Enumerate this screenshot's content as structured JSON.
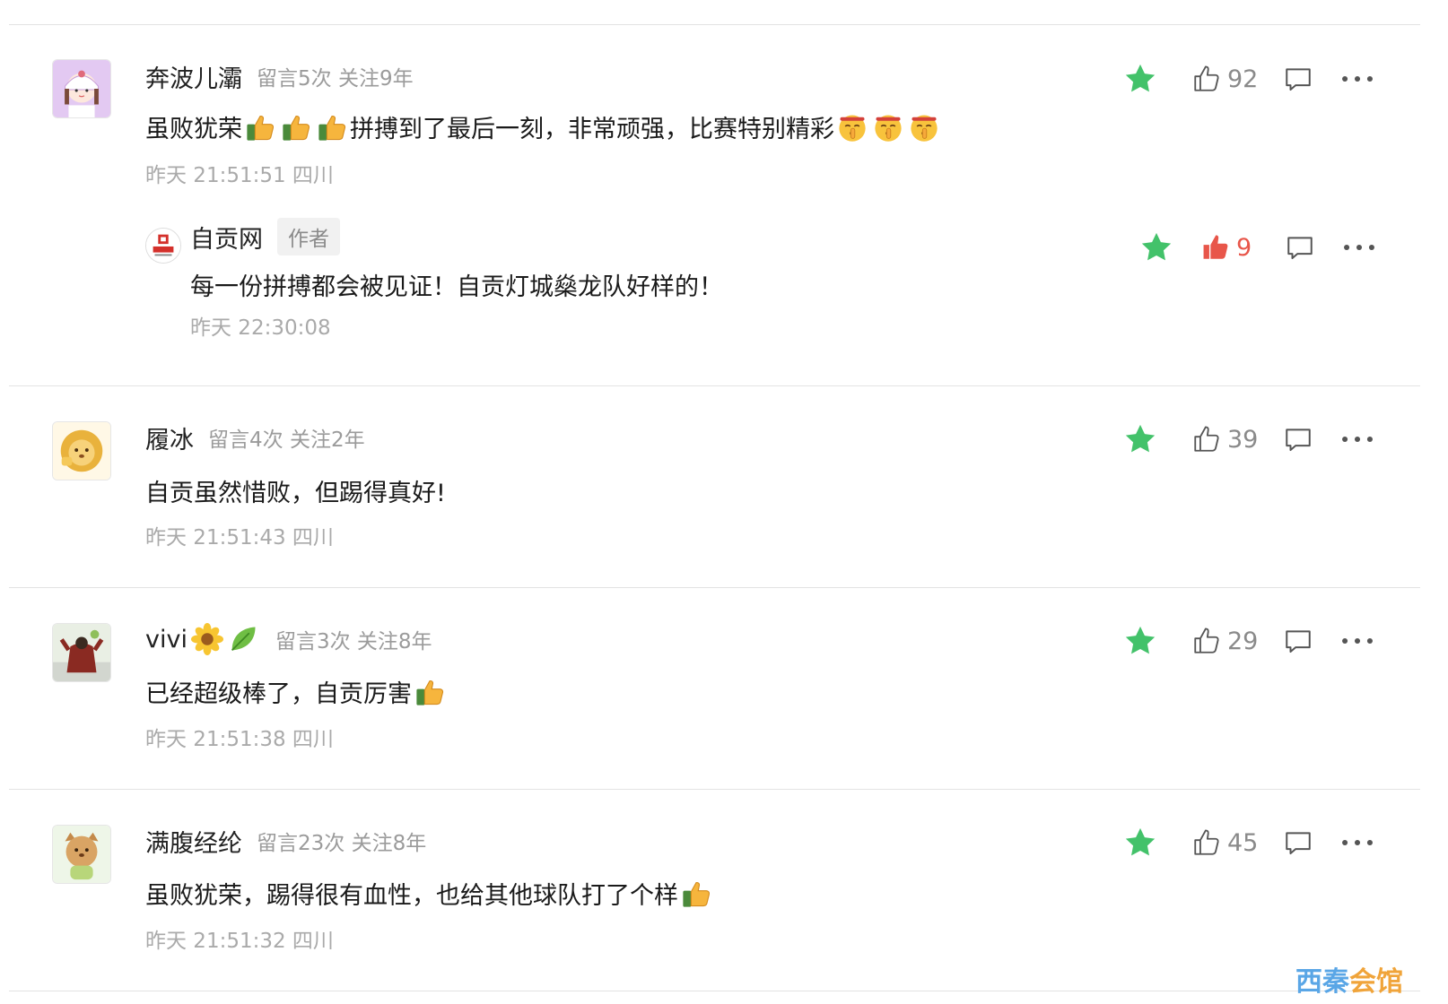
{
  "colors": {
    "accent_green": "#43c26a",
    "like_red": "#e8564a",
    "meta_gray": "#9b9b9b"
  },
  "comments": [
    {
      "nickname": "奔波儿灞",
      "meta": "留言5次 关注9年",
      "text_before": "虽败犹荣",
      "text_middle": "拼搏到了最后一刻，非常顽强，比赛特别精彩",
      "time": "昨天 21:51:51 四川",
      "likes": "92",
      "avatar_icon": "girl-avatar-icon",
      "reply": {
        "nickname": "自贡网",
        "badge": "作者",
        "text": "每一份拼搏都会被见证！自贡灯城燊龙队好样的！",
        "time": "昨天 22:30:08",
        "likes": "9",
        "avatar_icon": "zigong-logo-icon"
      }
    },
    {
      "nickname": "履冰",
      "meta": "留言4次 关注2年",
      "text": "自贡虽然惜败，但踢得真好!",
      "time": "昨天 21:51:43 四川",
      "likes": "39",
      "avatar_icon": "lion-avatar-icon"
    },
    {
      "nickname": "vivi",
      "meta": "留言3次 关注8年",
      "text": "已经超级棒了，自贡厉害",
      "time": "昨天 21:51:38 四川",
      "likes": "29",
      "avatar_icon": "photo-avatar-icon"
    },
    {
      "nickname": "满腹经纶",
      "meta": "留言23次 关注8年",
      "text": "虽败犹荣，踢得很有血性，也给其他球队打了个样",
      "time": "昨天 21:51:32 四川",
      "likes": "45",
      "avatar_icon": "cat-avatar-icon"
    }
  ],
  "watermark": {
    "part1": "西秦",
    "part2": "会馆"
  }
}
